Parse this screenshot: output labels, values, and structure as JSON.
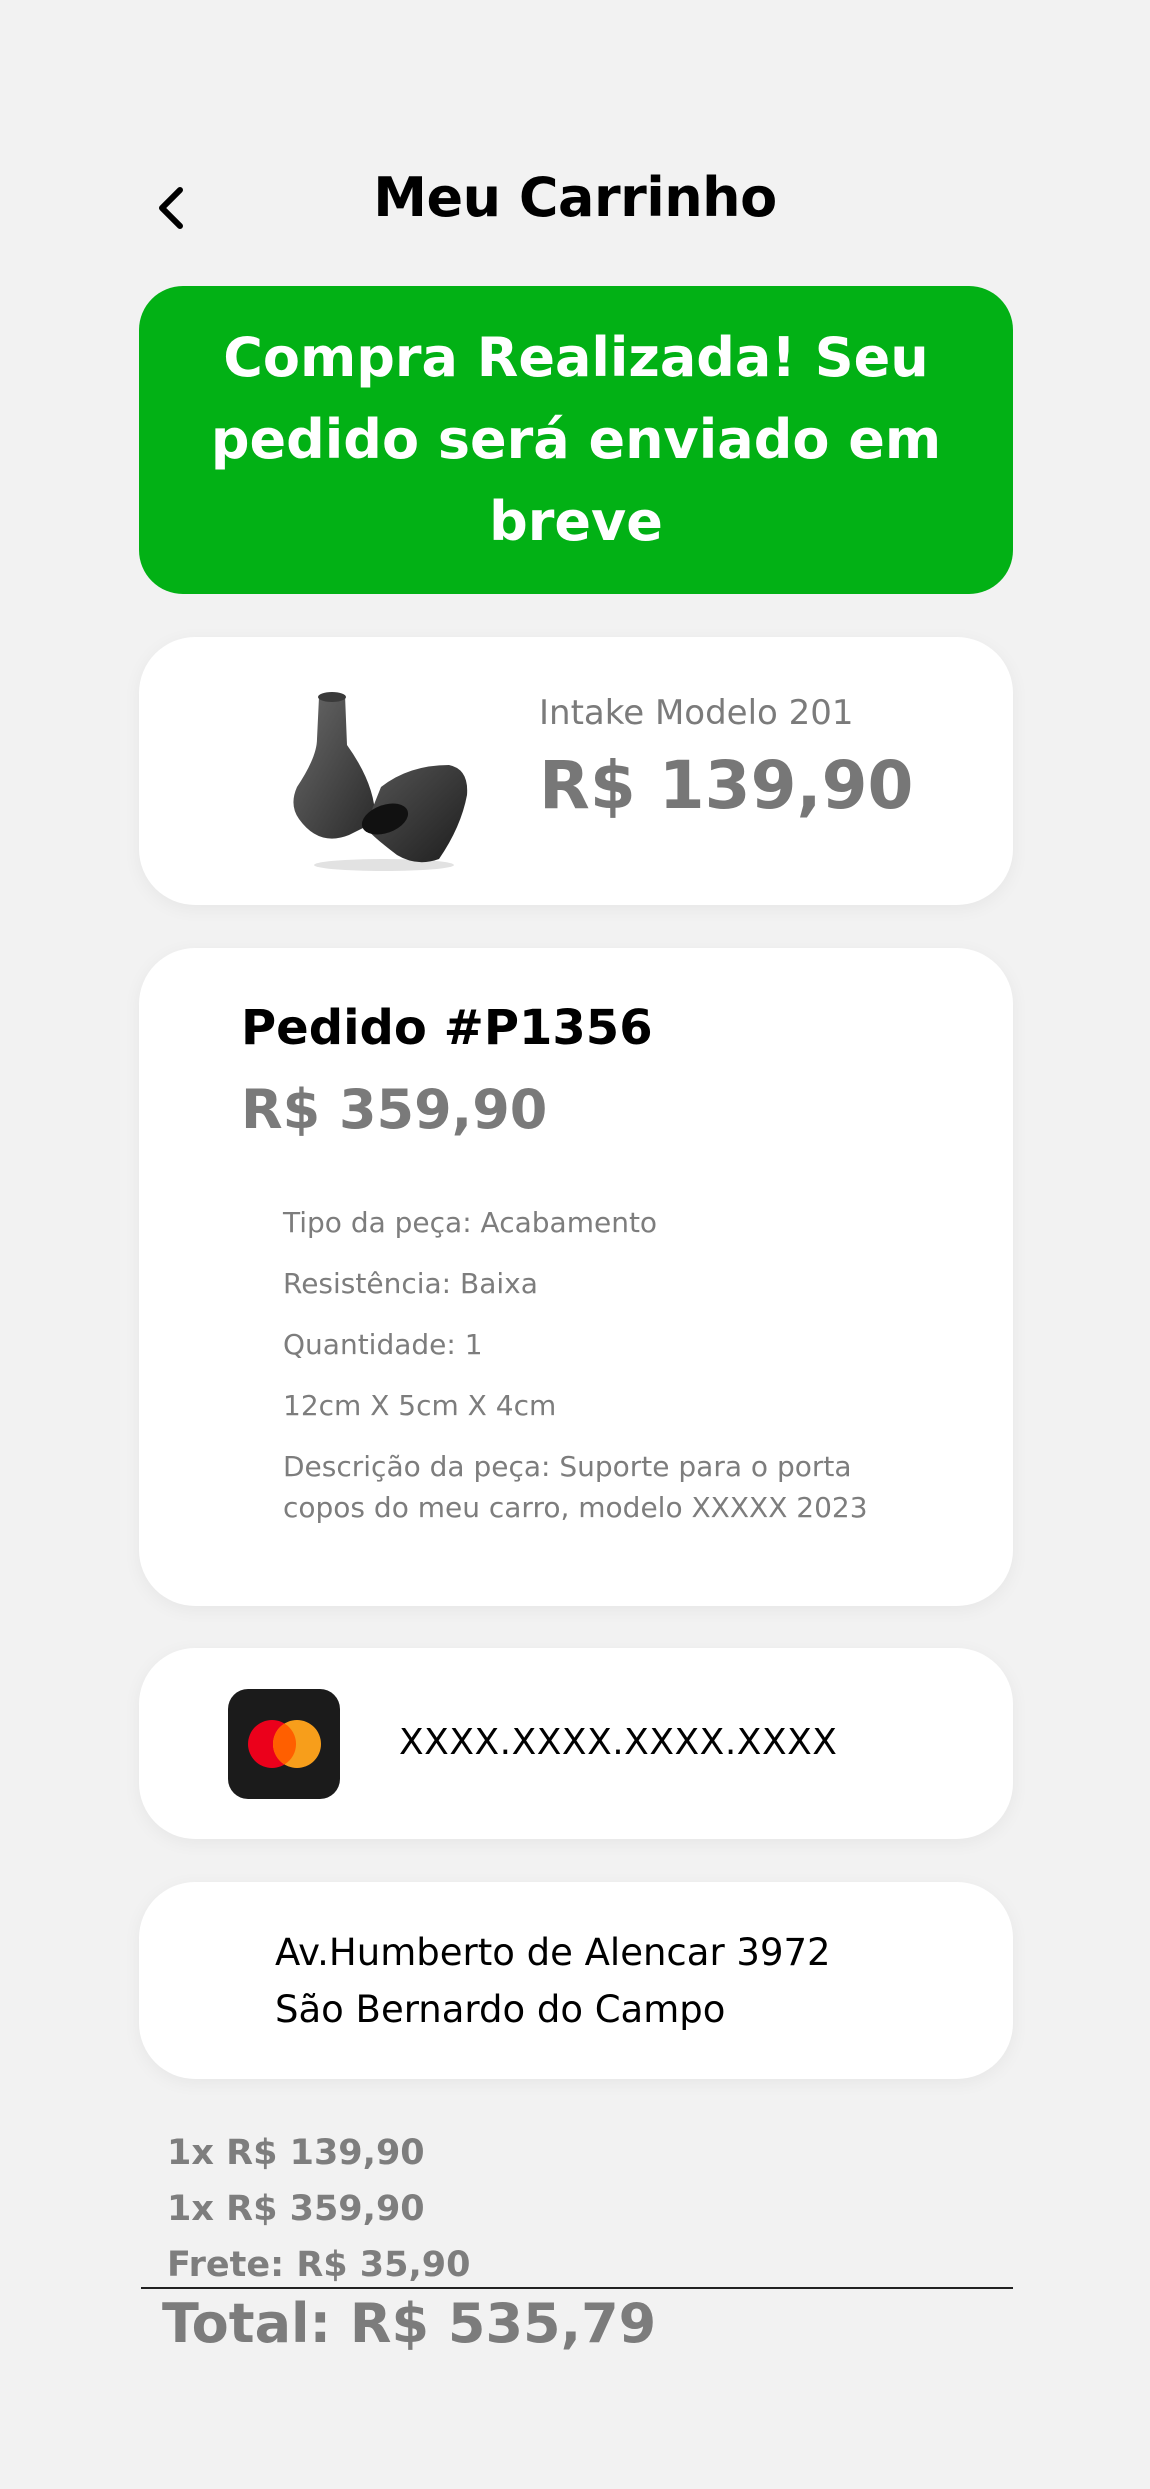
{
  "header": {
    "title": "Meu Carrinho"
  },
  "banner": {
    "message": "Compra Realizada! Seu pedido será enviado em breve",
    "color": "#02b115"
  },
  "product": {
    "name": "Intake Modelo 201",
    "price": "R$ 139,90",
    "image": "intake-part-image"
  },
  "order": {
    "title": "Pedido #P1356",
    "price": "R$ 359,90",
    "details": [
      "Tipo da peça: Acabamento",
      "Resistência: Baixa",
      "Quantidade: 1",
      "12cm X 5cm X 4cm",
      "Descrição da peça: Suporte para o porta copos do meu carro, modelo XXXXX 2023"
    ]
  },
  "payment": {
    "card_number": "XXXX.XXXX.XXXX.XXXX",
    "brand_icon": "mastercard-icon",
    "brand_colors": [
      "#eb001b",
      "#f79e1b"
    ]
  },
  "address": {
    "street": "Av.Humberto de Alencar 3972",
    "city": "São Bernardo do Campo"
  },
  "summary": {
    "lines": [
      "1x R$ 139,90",
      "1x R$ 359,90",
      "Frete: R$ 35,90"
    ],
    "total": "Total: R$ 535,79"
  }
}
